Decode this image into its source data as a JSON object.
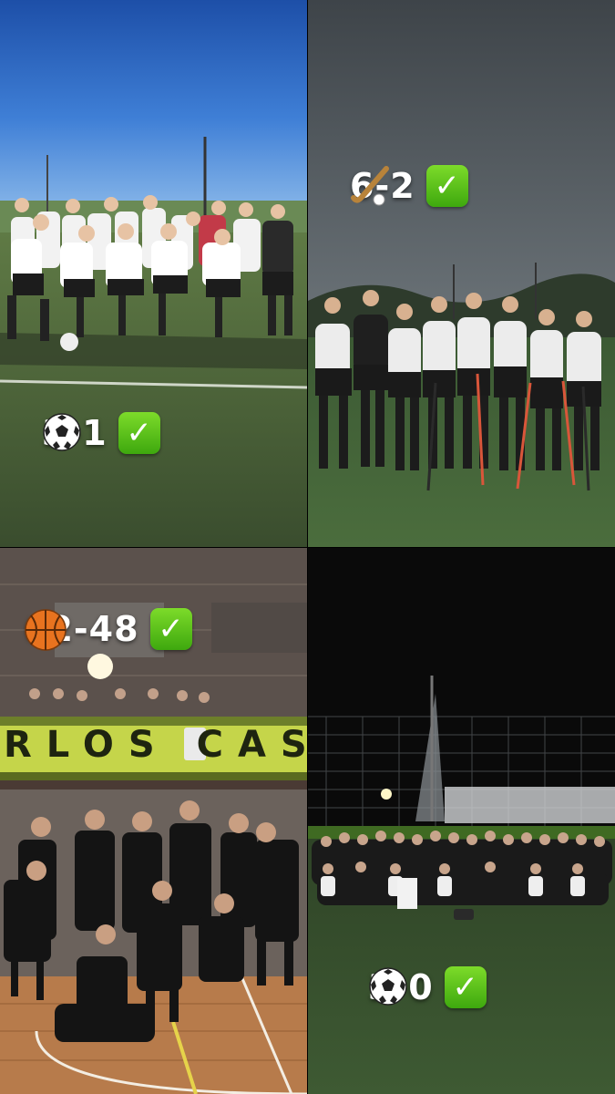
{
  "panels": [
    {
      "sport_icon": "soccer-ball-icon",
      "score": "3-1",
      "result_icon": "check-mark-icon"
    },
    {
      "sport_icon": "field-hockey-icon",
      "score": "6-2",
      "result_icon": "check-mark-icon"
    },
    {
      "sport_icon": "basketball-icon",
      "score": "62-48",
      "result_icon": "check-mark-icon"
    },
    {
      "sport_icon": "soccer-ball-icon",
      "score": "3-0",
      "result_icon": "check-mark-icon"
    }
  ],
  "banner": {
    "text": "RLOS CAS"
  },
  "colors": {
    "check": "#4cb81a",
    "field_green": "#3f5a2c",
    "sky_blue": "#1f55b8",
    "banner_green": "#b9cf3a"
  }
}
